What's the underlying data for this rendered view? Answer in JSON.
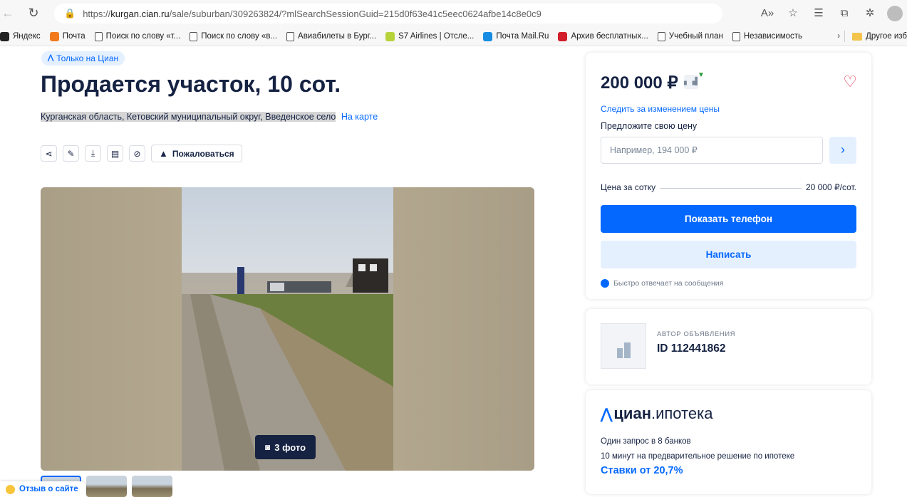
{
  "browser": {
    "url_prefix": "https://",
    "url_host": "kurgan.cian.ru",
    "url_path": "/sale/suburban/309263824/?mlSearchSessionGuid=215d0f63e41c5eec0624afbe14c8e0c9",
    "bookmarks": [
      {
        "label": "Яндекс",
        "icon": "yandex-icon",
        "color": "#222222"
      },
      {
        "label": "Почта",
        "icon": "mail-icon",
        "color": "#f27a1a"
      },
      {
        "label": "Поиск по слову «т...",
        "icon": "page-icon"
      },
      {
        "label": "Поиск по слову «в...",
        "icon": "page-icon"
      },
      {
        "label": "Авиабилеты в Бург...",
        "icon": "page-icon"
      },
      {
        "label": "S7 Airlines | Отсле...",
        "icon": "s7-icon",
        "color": "#b6d33a"
      },
      {
        "label": "Почта Mail.Ru",
        "icon": "mailru-icon",
        "color": "#168de2"
      },
      {
        "label": "Архив бесплатных...",
        "icon": "archive-icon",
        "color": "#d21d2a"
      },
      {
        "label": "Учебный план",
        "icon": "page-icon"
      },
      {
        "label": "Независимость",
        "icon": "page-icon"
      }
    ],
    "other_bookmarks": "Другое изб"
  },
  "listing": {
    "badge": "Только на Циан",
    "title": "Продается участок, 10 сот.",
    "address": "Курганская область, Кетовский муниципальный округ, Введенское село",
    "map_link": "На карте",
    "complain_label": "Пожаловаться",
    "photo_count": "3 фото"
  },
  "price": {
    "value": "200 000 ₽",
    "track_link": "Следить за изменением цены",
    "offer_label": "Предложите свою цену",
    "offer_placeholder": "Например, 194 000 ₽",
    "per_sotka_label": "Цена за сотку",
    "per_sotka_value": "20 000 ₽/сот.",
    "show_phone": "Показать телефон",
    "write": "Написать",
    "fast_reply": "Быстро отвечает на сообщения"
  },
  "author": {
    "label": "АВТОР ОБЪЯВЛЕНИЯ",
    "id": "ID 112441862"
  },
  "mortgage": {
    "brand": "циан",
    "suffix": ".ипотека",
    "line1": "Один запрос в 8 банков",
    "line2": "10 минут на предварительное решение по ипотеке",
    "rate": "Ставки от 20,7%"
  },
  "feedback": "Отзыв о сайте",
  "colors": {
    "accent": "#0468ff",
    "accent_light": "#e5f0ff",
    "text": "#152242",
    "heart": "#e84260"
  }
}
